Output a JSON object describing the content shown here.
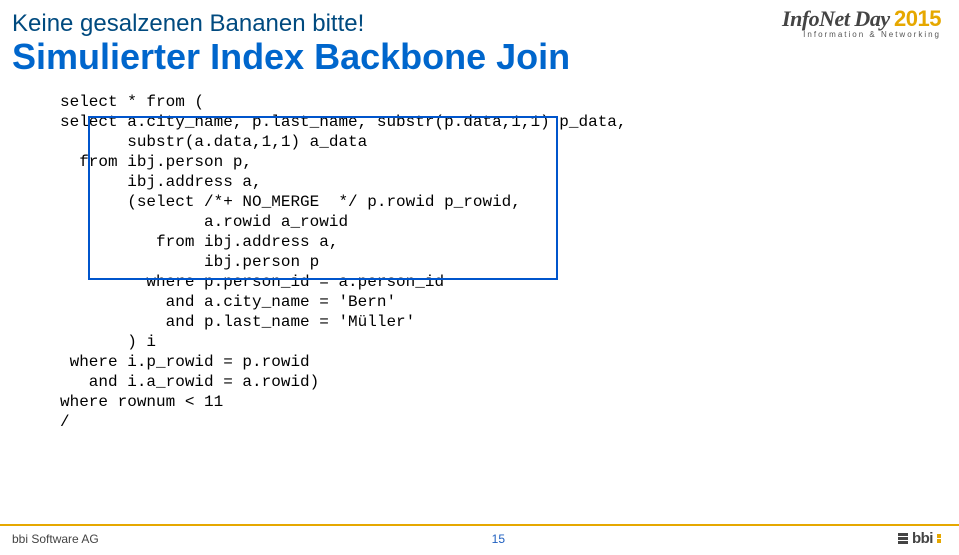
{
  "header": {
    "title": "Keine gesalzenen Bananen bitte!"
  },
  "logo": {
    "name": "InfoNet Day",
    "year": "2015",
    "tag": "Information & Networking"
  },
  "subtitle": "Simulierter Index Backbone Join",
  "code": "select * from (\nselect a.city_name, p.last_name, substr(p.data,1,1) p_data,\n       substr(a.data,1,1) a_data\n  from ibj.person p,\n       ibj.address a,\n       (select /*+ NO_MERGE  */ p.rowid p_rowid,\n               a.rowid a_rowid\n          from ibj.address a,\n               ibj.person p\n         where p.person_id = a.person_id\n           and a.city_name = 'Bern'\n           and p.last_name = 'Müller'\n       ) i\n where i.p_rowid = p.rowid\n   and i.a_rowid = a.rowid)\nwhere rownum < 11\n/",
  "footer": {
    "company": "bbi Software AG",
    "page": "15",
    "logo_text": "bbi"
  }
}
